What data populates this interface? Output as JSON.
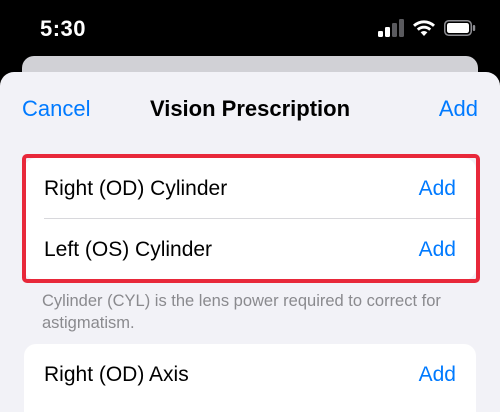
{
  "status_bar": {
    "time": "5:30",
    "icons": [
      "cellular-signal-icon",
      "wifi-icon",
      "battery-icon"
    ]
  },
  "nav": {
    "cancel_label": "Cancel",
    "title": "Vision Prescription",
    "add_label": "Add"
  },
  "cylinder_section": {
    "rows": [
      {
        "label": "Right (OD) Cylinder",
        "action": "Add"
      },
      {
        "label": "Left (OS) Cylinder",
        "action": "Add"
      }
    ],
    "footnote": "Cylinder (CYL) is the lens power required to correct for astigmatism."
  },
  "axis_section": {
    "rows": [
      {
        "label": "Right (OD) Axis",
        "action": "Add"
      }
    ]
  },
  "colors": {
    "accent": "#007aff",
    "highlight": "#e8283a",
    "sheet_background": "#f2f2f7",
    "footnote_text": "#8a8a8e"
  }
}
